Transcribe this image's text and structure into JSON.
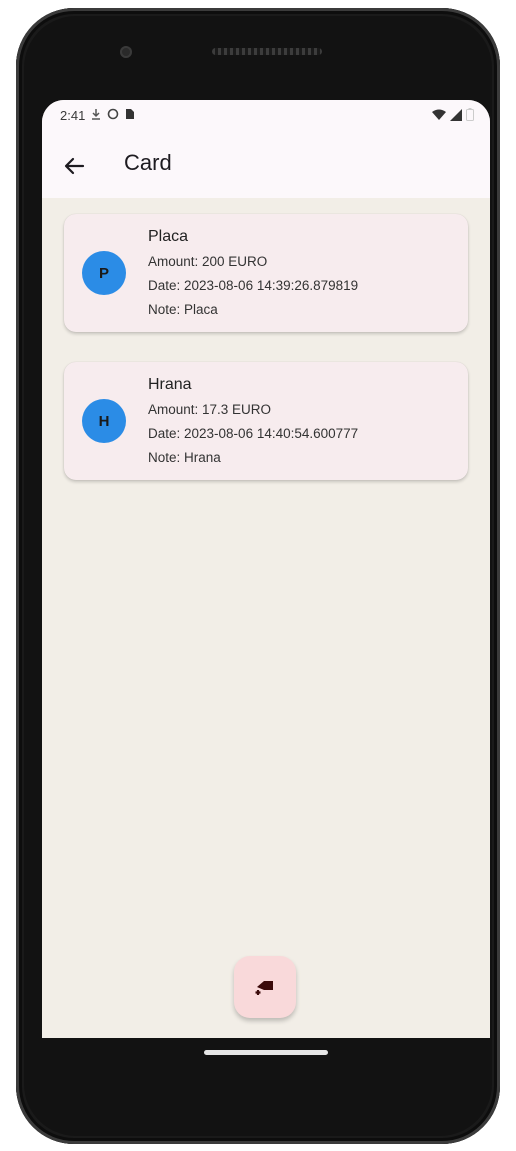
{
  "status_bar": {
    "time": "2:41",
    "icons_left": [
      "download-icon",
      "whatsapp-icon",
      "sim-card-icon"
    ],
    "icons_right": [
      "wifi-icon",
      "signal-icon",
      "battery-icon"
    ]
  },
  "app_bar": {
    "back_icon": "arrow-back-icon",
    "title": "Card"
  },
  "transactions": [
    {
      "initial": "P",
      "title": "Placa",
      "amount": "Amount: 200 EURO",
      "date": "Date: 2023-08-06 14:39:26.879819",
      "note": "Note: Placa"
    },
    {
      "initial": "H",
      "title": "Hrana",
      "amount": "Amount: 17.3 EURO",
      "date": "Date: 2023-08-06 14:40:54.600777",
      "note": "Note: Hrana"
    }
  ],
  "fab": {
    "icon": "add-card-icon"
  },
  "colors": {
    "screen_background": "#f2eee7",
    "card_background": "#f7ecee",
    "avatar": "#2b8ce6",
    "fab_background": "#f9d9da",
    "fab_icon": "#3b0a0a"
  }
}
